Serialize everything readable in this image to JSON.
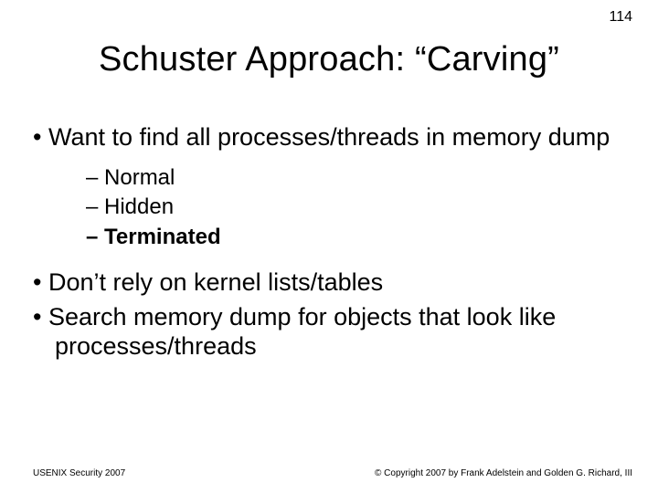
{
  "page_number": "114",
  "title": "Schuster Approach: “Carving”",
  "bullets": {
    "b1": "Want to find all processes/threads in memory dump",
    "sub": {
      "s1": "Normal",
      "s2": "Hidden",
      "s3": "Terminated"
    },
    "b2": "Don’t rely on kernel lists/tables",
    "b3": "Search memory dump for objects that look like processes/threads"
  },
  "footer": {
    "left": "USENIX Security 2007",
    "right": "© Copyright 2007 by Frank Adelstein and Golden G. Richard, III"
  }
}
